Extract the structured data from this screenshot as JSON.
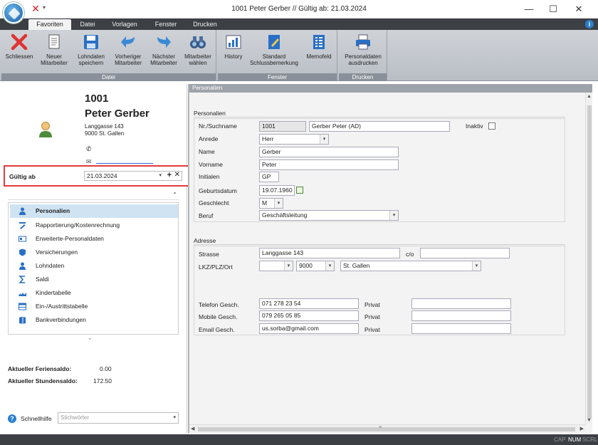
{
  "window": {
    "title": "1001 Peter Gerber // Gültig ab: 21.03.2024",
    "minimize": "—",
    "maximize": "☐",
    "close": "✕"
  },
  "ribbon": {
    "tabs": [
      "Favoriten",
      "Datei",
      "Vorlagen",
      "Fenster",
      "Drucken"
    ],
    "active_tab": "Favoriten",
    "groups": {
      "datei": {
        "label": "Datei",
        "buttons": [
          {
            "line1": "Schliessen",
            "line2": "",
            "icon": "close-x-icon"
          },
          {
            "line1": "Neuer",
            "line2": "Mitarbeiter",
            "icon": "new-document-icon"
          },
          {
            "line1": "Lohndaten",
            "line2": "speichern",
            "icon": "save-disk-icon"
          },
          {
            "line1": "Vorheriger",
            "line2": "Mitarbeiter",
            "icon": "arrow-back-icon"
          },
          {
            "line1": "Nächster",
            "line2": "Mitarbeiter",
            "icon": "arrow-forward-icon"
          },
          {
            "line1": "Mitarbeiter",
            "line2": "wählen",
            "icon": "binoculars-icon"
          }
        ]
      },
      "fenster": {
        "label": "Fenster",
        "buttons": [
          {
            "line1": "History",
            "line2": "",
            "icon": "history-chart-icon"
          },
          {
            "line1": "Standard",
            "line2": "Schlussbemerkung",
            "icon": "note-pencil-icon"
          },
          {
            "line1": "Memofeld",
            "line2": "",
            "icon": "memo-grid-icon"
          }
        ]
      },
      "drucken": {
        "label": "Drucken",
        "buttons": [
          {
            "line1": "Personaldaten",
            "line2": "ausdrucken",
            "icon": "printer-icon"
          }
        ]
      }
    }
  },
  "employee": {
    "number": "1001",
    "name": "Peter Gerber",
    "street": "Langgasse 143",
    "city": "9000 St. Gallen"
  },
  "valid_from": {
    "label": "Gültig ab",
    "value": "21.03.2024",
    "dropdown": "▾",
    "plus": "+",
    "clear": "✕"
  },
  "nav": {
    "collapse_glyph": "⌃",
    "items": [
      {
        "label": "Personalien",
        "icon": "person-icon",
        "active": true
      },
      {
        "label": "Rapportierung/Kostenrechnung",
        "icon": "report-pen-icon",
        "active": false
      },
      {
        "label": "Erweiterte-Personaldaten",
        "icon": "id-card-icon",
        "active": false
      },
      {
        "label": "Versicherungen",
        "icon": "shield-icon",
        "active": false
      },
      {
        "label": "Lohndaten",
        "icon": "person-money-icon",
        "active": false
      },
      {
        "label": "Saldi",
        "icon": "sigma-icon",
        "active": false
      },
      {
        "label": "Kindertabelle",
        "icon": "children-icon",
        "active": false
      },
      {
        "label": "Ein-/Austrittstabelle",
        "icon": "table-icon",
        "active": false
      },
      {
        "label": "Bankverbindungen",
        "icon": "bank-book-icon",
        "active": false
      }
    ]
  },
  "saldi": {
    "ferien_label": "Aktueller Feriensaldo:",
    "ferien_value": "0.00",
    "stunden_label": "Aktueller Stundensaldo:",
    "stunden_value": "172.50"
  },
  "quickhelp": {
    "label": "Schnellhilfe",
    "placeholder": "Stichwörter"
  },
  "form": {
    "panel_title": "Personalien",
    "personalien": {
      "section_title": "Personalien",
      "nr_label": "Nr./Suchname",
      "nr_value": "1001",
      "suchname_value": "Gerber Peter (AD)",
      "inaktiv_label": "Inaktiv",
      "anrede_label": "Anrede",
      "anrede_value": "Herr",
      "name_label": "Name",
      "name_value": "Gerber",
      "vorname_label": "Vorname",
      "vorname_value": "Peter",
      "initialen_label": "Initialen",
      "initialen_value": "GP",
      "geburtsdatum_label": "Geburtsdatum",
      "geburtsdatum_value": "19.07.1960",
      "geschlecht_label": "Geschlecht",
      "geschlecht_value": "M",
      "beruf_label": "Beruf",
      "beruf_value": "Geschäftsleitung"
    },
    "adresse": {
      "section_title": "Adresse",
      "strasse_label": "Strasse",
      "strasse_value": "Langgasse 143",
      "co_label": "c/o",
      "co_value": "",
      "ort_label": "LKZ/PLZ/Ort",
      "lkz_value": "",
      "plz_value": "9000",
      "ort_value": "St. Gallen",
      "telefon_label": "Telefon Gesch.",
      "telefon_value": "071 278 23 54",
      "mobile_label": "Mobile Gesch.",
      "mobile_value": "079 265 05 85",
      "email_label": "Email Gesch.",
      "email_value": "us.sorba@gmail.com",
      "privat_label": "Privat",
      "privat_tel": "",
      "privat_mobile": "",
      "privat_email": ""
    }
  },
  "statusbar": {
    "cap": "CAP",
    "num": "NUM",
    "scrl": "SCRL"
  },
  "colors": {
    "highlight_border": "#e43b3b",
    "nav_active": "#cfe3f3",
    "ribbon_dark": "#3c3f44"
  }
}
